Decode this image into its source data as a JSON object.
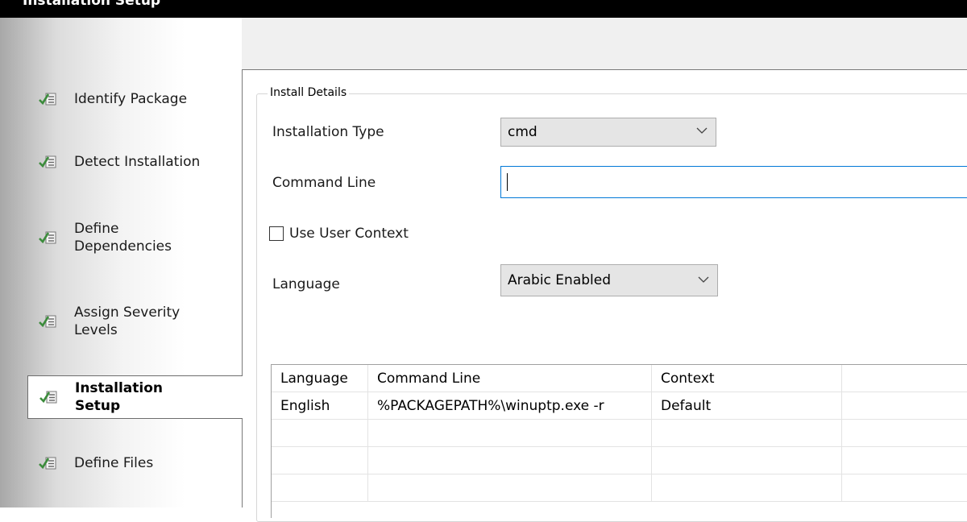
{
  "window": {
    "title": "Installation Setup"
  },
  "sidebar": {
    "items": [
      {
        "label_line1": "Identify Package",
        "label_line2": "",
        "icon": "checklist-icon",
        "selected": false
      },
      {
        "label_line1": "Detect Installation",
        "label_line2": "",
        "icon": "checklist-icon",
        "selected": false
      },
      {
        "label_line1": "Define",
        "label_line2": "Dependencies",
        "icon": "checklist-icon",
        "selected": false
      },
      {
        "label_line1": "Assign Severity",
        "label_line2": "Levels",
        "icon": "checklist-icon",
        "selected": false
      },
      {
        "label_line1": "Installation",
        "label_line2": "Setup",
        "icon": "checklist-icon",
        "selected": true
      },
      {
        "label_line1": "Define Files",
        "label_line2": "",
        "icon": "checklist-icon",
        "selected": false
      }
    ]
  },
  "install_details": {
    "group_title": "Install Details",
    "installation_type_label": "Installation Type",
    "installation_type_value": "cmd",
    "command_line_label": "Command Line",
    "command_line_value": "",
    "use_user_context_label": "Use User Context",
    "use_user_context_checked": false,
    "language_label": "Language",
    "language_value": "Arabic Enabled"
  },
  "table": {
    "columns": [
      "Language",
      "Command Line",
      "Context",
      ""
    ],
    "rows": [
      [
        "English",
        "%PACKAGEPATH%\\winuptp.exe -r",
        "Default",
        ""
      ],
      [
        "",
        "",
        "",
        ""
      ],
      [
        "",
        "",
        "",
        ""
      ],
      [
        "",
        "",
        "",
        ""
      ]
    ]
  },
  "colors": {
    "title_bar": "#000000",
    "focus_border": "#0078d7",
    "combo_bg": "#e5e5e5",
    "check_icon_green": "#3c8c3c"
  }
}
